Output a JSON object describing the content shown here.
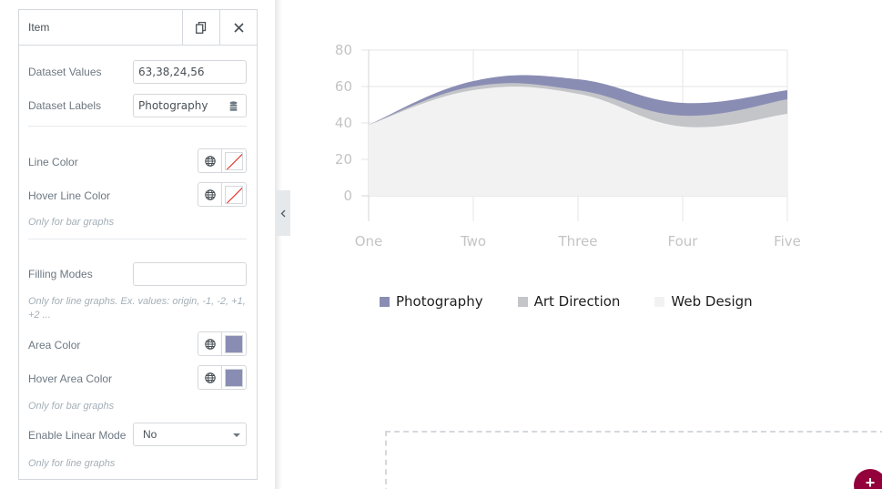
{
  "panel": {
    "title": "Item",
    "copy_icon": "copy-icon",
    "close_icon": "close-icon",
    "dataset_values": {
      "label": "Dataset Values",
      "value": "63,38,24,56"
    },
    "dataset_labels": {
      "label": "Dataset Labels",
      "value": "Photography",
      "icon": "database-icon"
    },
    "line_color": {
      "label": "Line Color",
      "value": "none"
    },
    "hover_line_color": {
      "label": "Hover Line Color",
      "value": "none"
    },
    "line_color_help": "Only for bar graphs",
    "filling_modes": {
      "label": "Filling Modes",
      "value": "",
      "help": "Only for line graphs. Ex. values: origin, -1, -2, +1, +2 ..."
    },
    "area_color": {
      "label": "Area Color",
      "value": "#8a8db3"
    },
    "hover_area_color": {
      "label": "Hover Area Color",
      "value": "#8a8db3"
    },
    "area_color_help": "Only for bar graphs",
    "linear_mode": {
      "label": "Enable Linear Mode",
      "value": "No",
      "help": "Only for line graphs"
    }
  },
  "collapse_icon": "chevron-left-icon",
  "add_button": {
    "label": "+",
    "color": "#93003c"
  },
  "chart_data": {
    "type": "area",
    "categories": [
      "One",
      "Two",
      "Three",
      "Four",
      "Five"
    ],
    "series": [
      {
        "name": "Photography",
        "color": "#8a8db3",
        "values": [
          39,
          63,
          64,
          51,
          58
        ]
      },
      {
        "name": "Art Direction",
        "color": "#c4c5c9",
        "values": [
          39,
          60,
          58,
          44,
          53
        ]
      },
      {
        "name": "Web Design",
        "color": "#f2f2f2",
        "values": [
          39,
          58,
          56,
          38,
          45
        ]
      }
    ],
    "yticks": [
      "0",
      "20",
      "40",
      "60",
      "80"
    ],
    "ylim": [
      0,
      80
    ],
    "grid": true,
    "legend": "bottom",
    "title": "",
    "xlabel": "",
    "ylabel": ""
  }
}
